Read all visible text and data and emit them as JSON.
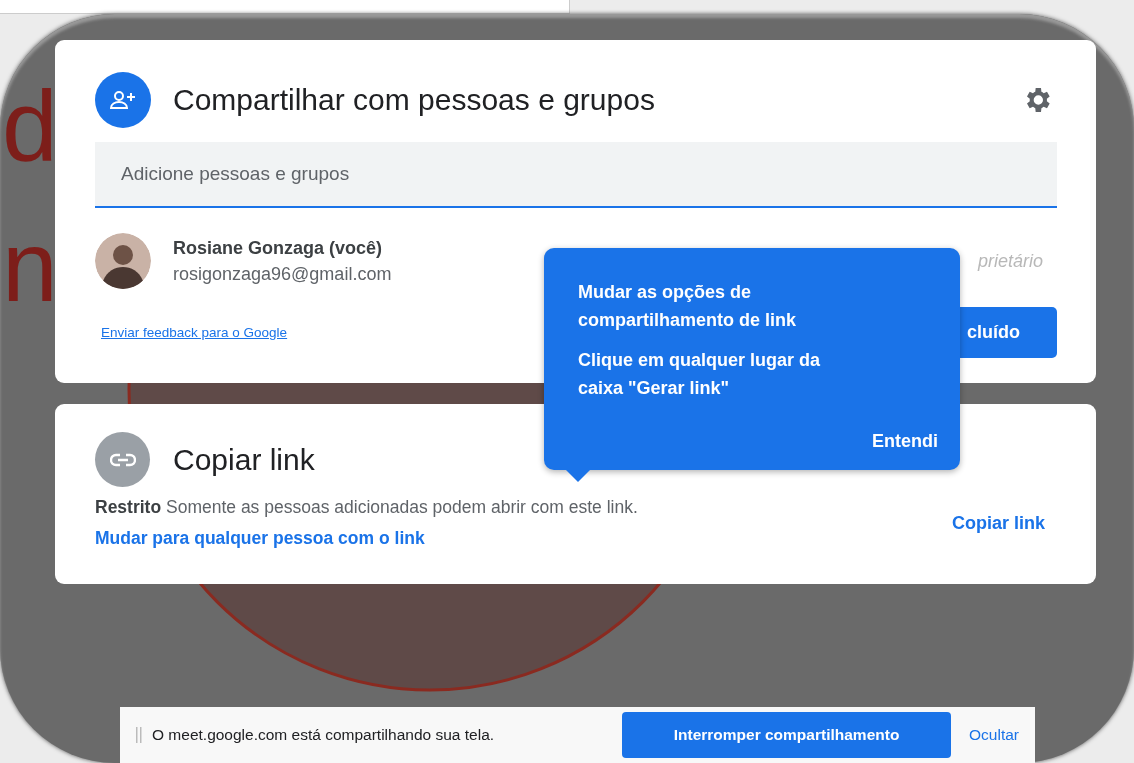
{
  "backdrop": {
    "letters": [
      "d",
      "n"
    ]
  },
  "share_dialog": {
    "title": "Compartilhar com pessoas e grupos",
    "input": {
      "placeholder": "Adicione pessoas e grupos"
    },
    "people": [
      {
        "name": "Rosiane Gonzaga (você)",
        "email": "rosigonzaga96@gmail.com",
        "role": "prietário"
      }
    ],
    "feedback_link": "Enviar feedback para o Google",
    "done_button": "cluído"
  },
  "link_card": {
    "title": "Copiar link",
    "access": "**Restrito** Somente as pessoas adicionadas podem abrir com este link.",
    "change_link": "Mudar para qualquer pessoa com o link",
    "copy_button": "Copiar link"
  },
  "tooltip": {
    "title": "Mudar as opções de compartilhamento de link",
    "body": "Clique em qualquer lugar da caixa \"Gerar link\"",
    "button": "Entendi"
  },
  "share_bar": {
    "message": "O meet.google.com está compartilhando sua tela.",
    "stop_button": "Interromper compartilhamento",
    "hide_link": "Ocultar"
  }
}
